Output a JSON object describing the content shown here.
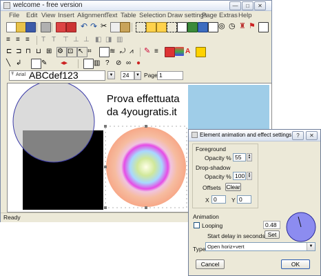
{
  "app": {
    "title": "welcome - free version",
    "menu": [
      "File",
      "Edit",
      "View",
      "Insert",
      "Alignment",
      "Text",
      "Table",
      "Selection",
      "Draw settings",
      "Page",
      "Extras",
      "Help"
    ],
    "font_name": "Arial",
    "font_preview": "ABCdef123",
    "font_size": "24",
    "page_label": "Page",
    "page_number": "1",
    "status": "Ready"
  },
  "canvas": {
    "text_line1": "Prova effettuata",
    "text_line2": "da 4yougratis.it"
  },
  "dialog": {
    "title": "Element animation and effect settings",
    "foreground_label": "Foreground",
    "opacity_label": "Opacity %",
    "foreground_opacity": "55",
    "dropshadow_label": "Drop-shadow",
    "shadow_opacity": "100",
    "offsets_label": "Offsets",
    "clear_button": "Clear",
    "x_label": "X",
    "x_value": "0",
    "y_label": "Y",
    "y_value": "0",
    "animation_label": "Animation",
    "looping_label": "Looping",
    "delay_value": "0.48",
    "delay_label": "Start delay in seconds",
    "set_button": "Set",
    "type_label": "Type",
    "type_value": "Open horiz+vert",
    "cancel_button": "Cancel",
    "ok_button": "OK",
    "help_button": "?",
    "close_button": "✕"
  },
  "colors": {
    "circle_gray": "#c8c8c8",
    "square": "#000000",
    "blue_rect": "#9fcde8",
    "dial_fill": "#8c8cf0"
  },
  "icons": [
    "minimize-icon",
    "maximize-icon",
    "close-icon",
    "new-doc-icon",
    "open-icon",
    "save-icon",
    "print-icon",
    "undo-icon",
    "redo-icon",
    "cut-icon",
    "copy-icon",
    "paste-icon",
    "bold-icon",
    "italic-icon",
    "underline-icon",
    "flag-icon"
  ]
}
